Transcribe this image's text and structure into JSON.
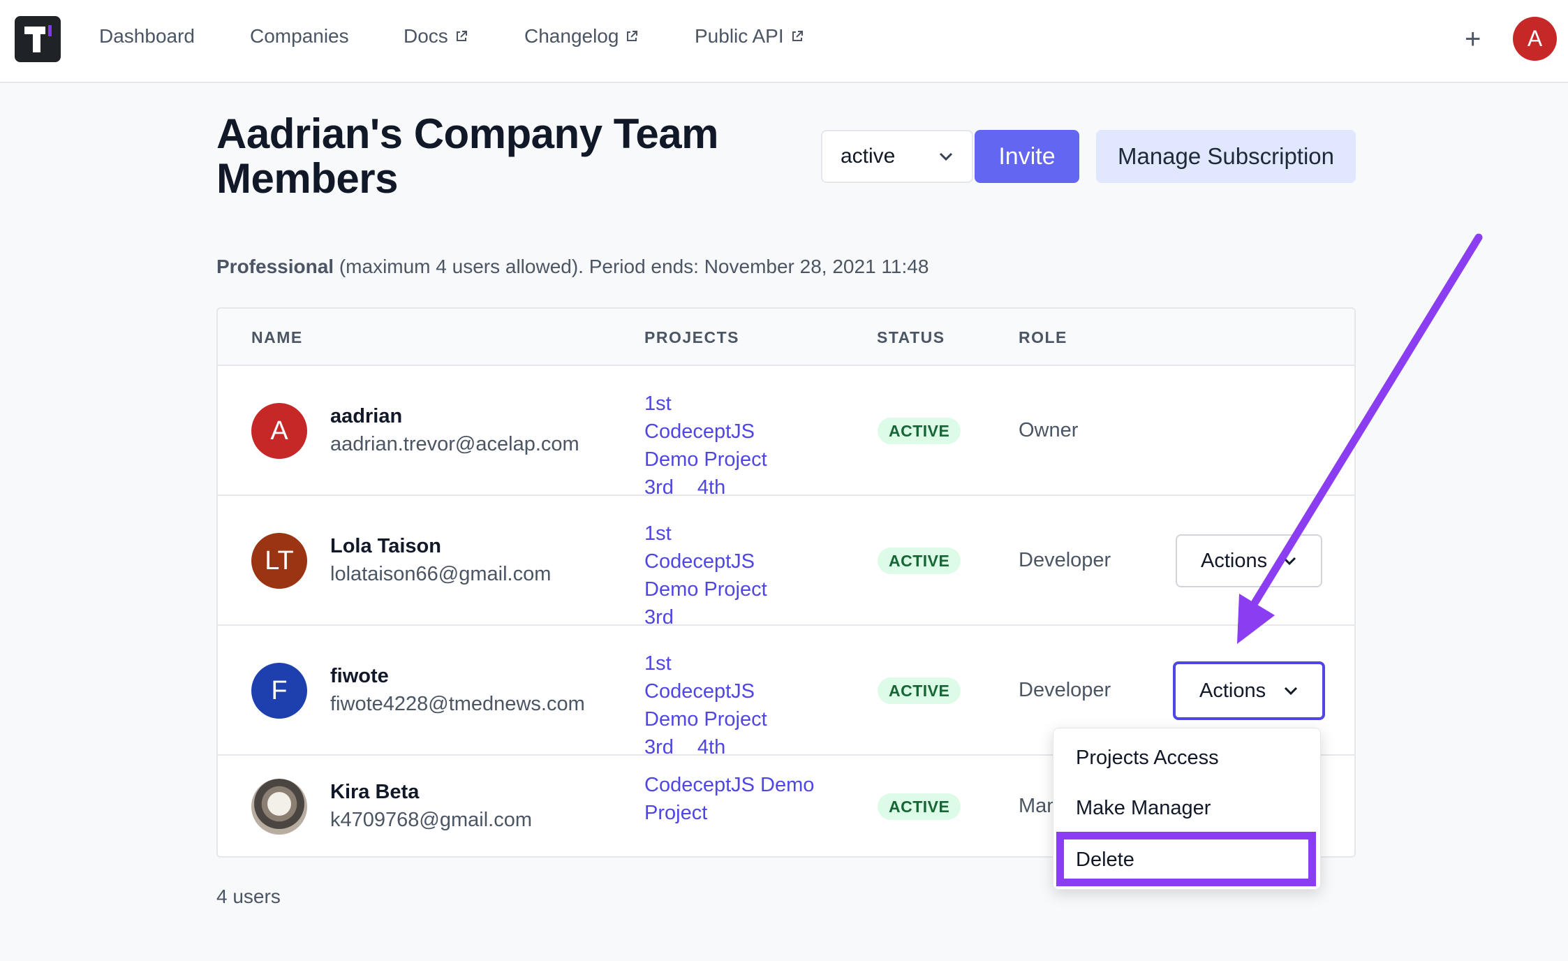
{
  "nav": {
    "items": [
      {
        "label": "Dashboard",
        "external": false
      },
      {
        "label": "Companies",
        "external": false
      },
      {
        "label": "Docs",
        "external": true
      },
      {
        "label": "Changelog",
        "external": true
      },
      {
        "label": "Public API",
        "external": true
      }
    ],
    "avatar_letter": "A",
    "icons": [
      "logo-icon",
      "external-link-icon",
      "plus-icon"
    ]
  },
  "header": {
    "title": "Aadrian's Company Team Members",
    "status_filter": "active",
    "invite_label": "Invite",
    "manage_label": "Manage Subscription"
  },
  "plan": {
    "name": "Professional",
    "details": "(maximum 4 users allowed). Period ends: November 28, 2021 11:48"
  },
  "table": {
    "columns": [
      "NAME",
      "PROJECTS",
      "STATUS",
      "ROLE"
    ],
    "rows": [
      {
        "initials": "A",
        "avatar_color": "#c62828",
        "name": "aadrian",
        "email": "aadrian.trevor@acelap.com",
        "projects": [
          "1st",
          "CodeceptJS",
          "Demo Project",
          "3rd",
          "4th"
        ],
        "status": "ACTIVE",
        "role": "Owner",
        "actions": ""
      },
      {
        "initials": "LT",
        "avatar_color": "#9a3412",
        "name": "Lola Taison",
        "email": "lolataison66@gmail.com",
        "projects": [
          "1st",
          "CodeceptJS",
          "Demo Project",
          "3rd"
        ],
        "status": "ACTIVE",
        "role": "Developer",
        "actions": "Actions"
      },
      {
        "initials": "F",
        "avatar_color": "#1e40af",
        "name": "fiwote",
        "email": "fiwote4228@tmednews.com",
        "projects": [
          "1st",
          "CodeceptJS",
          "Demo Project",
          "3rd",
          "4th"
        ],
        "status": "ACTIVE",
        "role": "Developer",
        "actions": "Actions"
      },
      {
        "initials": "",
        "avatar_color": "",
        "name": "Kira Beta",
        "email": "k4709768@gmail.com",
        "projects": [
          "CodeceptJS Demo",
          "Project"
        ],
        "status": "ACTIVE",
        "role": "Man",
        "actions": ""
      }
    ]
  },
  "footer": {
    "count": "4 users"
  },
  "dropdown": {
    "items": [
      "Projects Access",
      "Make Manager",
      "Delete"
    ],
    "highlighted": "Delete"
  },
  "annotation": {
    "arrow_color": "#8b3df1"
  }
}
